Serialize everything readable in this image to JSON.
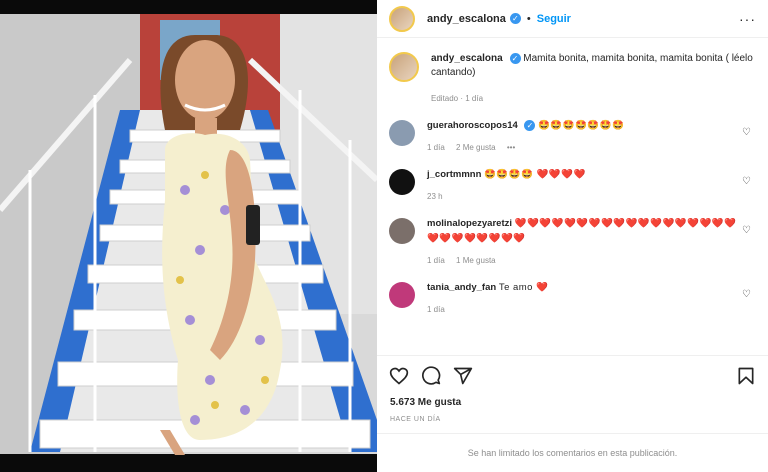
{
  "post": {
    "username": "andy_escalona",
    "follow_label": "Seguir",
    "more_label": "···"
  },
  "caption": {
    "username": "andy_escalona",
    "text": "Mamita bonita, mamita bonita, mamita bonita ( léelo cantando)",
    "meta": "Editado · 1 día"
  },
  "comments": [
    {
      "username": "guerahoroscopos14",
      "verified": true,
      "text": "🤩🤩🤩🤩🤩🤩🤩",
      "time": "1 día",
      "likes": "2 Me gusta",
      "more": "•••",
      "avatar_color": "#8a9bb0"
    },
    {
      "username": "j_cortmmnn",
      "verified": false,
      "text": "🤩🤩🤩🤩 ❤️❤️❤️❤️",
      "time": "23 h",
      "likes": "",
      "more": "",
      "avatar_color": "#111111"
    },
    {
      "username": "molinalopezyaretzi",
      "verified": false,
      "text": "❤️❤️❤️❤️❤️❤️❤️❤️❤️❤️❤️❤️❤️❤️❤️❤️❤️❤️❤️❤️❤️❤️❤️❤️❤️❤️",
      "time": "1 día",
      "likes": "1 Me gusta",
      "more": "",
      "avatar_color": "#7b6f6a"
    },
    {
      "username": "tania_andy_fan",
      "verified": false,
      "text": "Te amo ❤️",
      "time": "1 día",
      "likes": "",
      "more": "",
      "avatar_color": "#c0397a"
    }
  ],
  "stats": {
    "likes": "5.673 Me gusta",
    "date": "HACE UN DÍA"
  },
  "footer": {
    "limited_text": "Se han limitado los comentarios en esta publicación."
  },
  "icons": {
    "verified": "verified-badge-icon",
    "like": "heart-icon",
    "comment": "comment-icon",
    "share": "share-icon",
    "save": "bookmark-icon"
  },
  "colors": {
    "accent": "#0095f6",
    "verified": "#3897f0",
    "muted": "#8e8e8e"
  }
}
